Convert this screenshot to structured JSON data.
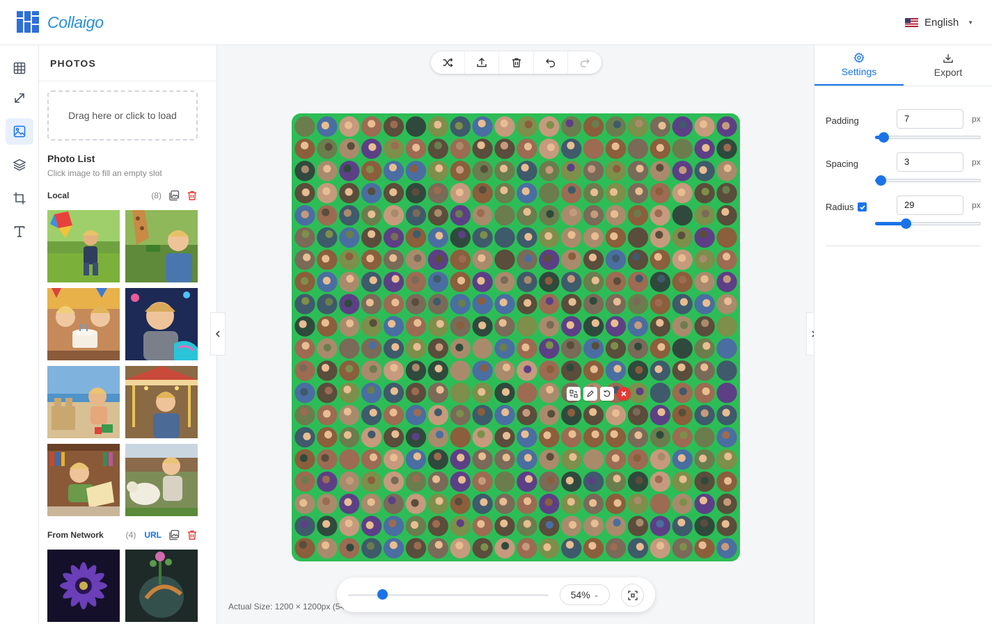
{
  "app": {
    "name": "Collaigo"
  },
  "header": {
    "language": "English",
    "colors": {
      "brand": "#2a8fd6",
      "logo": "#2f6fd6"
    }
  },
  "rail": {
    "items": [
      {
        "name": "layout-grid-icon",
        "active": false
      },
      {
        "name": "resize-icon",
        "active": false
      },
      {
        "name": "photos-icon",
        "active": true
      },
      {
        "name": "layers-icon",
        "active": false
      },
      {
        "name": "crop-icon",
        "active": false
      },
      {
        "name": "text-icon",
        "active": false
      }
    ]
  },
  "photos_panel": {
    "title": "PHOTOS",
    "dropzone": "Drag here or click to load",
    "list_title": "Photo List",
    "list_hint": "Click image to fill an empty slot",
    "local": {
      "label": "Local",
      "count": "(8)",
      "thumbs": [
        "boy-kite",
        "boy-giraffe",
        "kids-birthday-cake",
        "boy-arcade",
        "boy-sandcastle",
        "boy-carousel",
        "boy-reading",
        "boy-lamb"
      ]
    },
    "network": {
      "label": "From Network",
      "count": "(4)",
      "url_label": "URL",
      "thumbs": [
        "purple-flower",
        "glass-vase"
      ]
    }
  },
  "toolbar": {
    "buttons": [
      "shuffle-icon",
      "upload-icon",
      "trash-icon",
      "undo-icon",
      "redo-icon"
    ]
  },
  "canvas": {
    "background": "#2dbd56",
    "grid": {
      "cols": 20,
      "rows": 20
    },
    "cell_colors": [
      "#9c6b52",
      "#5a4d3b",
      "#7d8f4a",
      "#3f5a6b",
      "#c69a7d",
      "#6b7d4d",
      "#4a6ea1",
      "#8b5e3c",
      "#5d3f86",
      "#a98b6c",
      "#7a6a58",
      "#2f4a3c"
    ]
  },
  "zoom": {
    "value": "54%",
    "fraction": 0.17
  },
  "status": {
    "actual_size": "Actual Size: 1200 × 1200px (54%)"
  },
  "settings": {
    "tabs": [
      {
        "label": "Settings",
        "active": true
      },
      {
        "label": "Export",
        "active": false
      }
    ],
    "padding": {
      "label": "Padding",
      "value": "7",
      "unit": "px",
      "fraction": 0.08
    },
    "spacing": {
      "label": "Spacing",
      "value": "3",
      "unit": "px",
      "fraction": 0.05
    },
    "radius": {
      "label": "Radius",
      "value": "29",
      "unit": "px",
      "enabled": true,
      "fraction": 0.29
    }
  }
}
